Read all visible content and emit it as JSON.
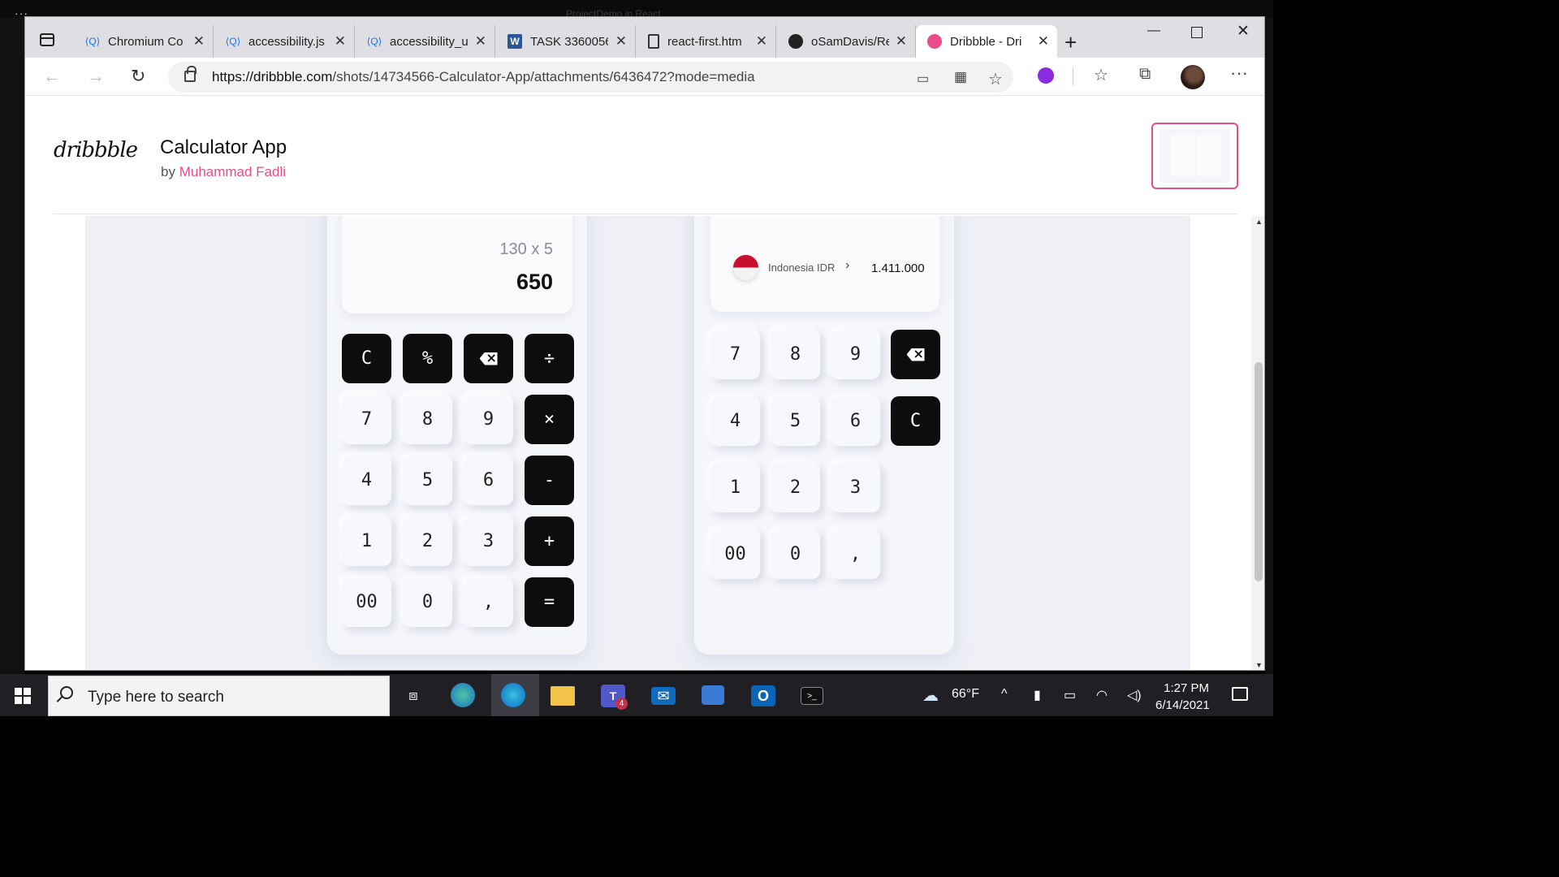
{
  "desktop": {
    "ghost_title": "ProjectDemo in React..."
  },
  "browser": {
    "tabs": [
      {
        "label": "Chromium Co",
        "icon": "chromium-code-search-icon"
      },
      {
        "label": "accessibility.js",
        "icon": "chromium-code-search-icon"
      },
      {
        "label": "accessibility_u",
        "icon": "chromium-code-search-icon"
      },
      {
        "label": "TASK 3360056",
        "icon": "word-icon"
      },
      {
        "label": "react-first.htm",
        "icon": "file-icon"
      },
      {
        "label": "oSamDavis/Re",
        "icon": "github-icon"
      },
      {
        "label": "Dribbble - Dri",
        "icon": "dribbble-icon",
        "active": true
      }
    ],
    "url_host": "https://dribbble.com",
    "url_path": "/shots/14734566-Calculator-App/attachments/6436472?mode=media"
  },
  "page": {
    "logo": "dribbble",
    "title": "Calculator App",
    "by": "by",
    "author": "Muhammad Fadli"
  },
  "calc1": {
    "expression": "130 x 5",
    "result": "650",
    "keys": [
      "C",
      "%",
      "⌫",
      "÷",
      "7",
      "8",
      "9",
      "×",
      "4",
      "5",
      "6",
      "-",
      "1",
      "2",
      "3",
      "+",
      "00",
      "0",
      ",",
      "="
    ]
  },
  "calc2": {
    "currency_name": "Indonesia IDR",
    "currency_value": "1.411.000",
    "keys": [
      "7",
      "8",
      "9",
      "⌫",
      "4",
      "5",
      "6",
      "C",
      "1",
      "2",
      "3",
      "00",
      "0",
      ","
    ]
  },
  "taskbar": {
    "search_placeholder": "Type here to search",
    "weather": "66°F",
    "time": "1:27 PM",
    "date": "6/14/2021",
    "teams_badge": "4"
  },
  "colors": {
    "accent": "#ea4c89",
    "key_dark": "#0d0d0d",
    "tab_bar": "#dfdfe3",
    "taskbar": "#1f1f24"
  }
}
